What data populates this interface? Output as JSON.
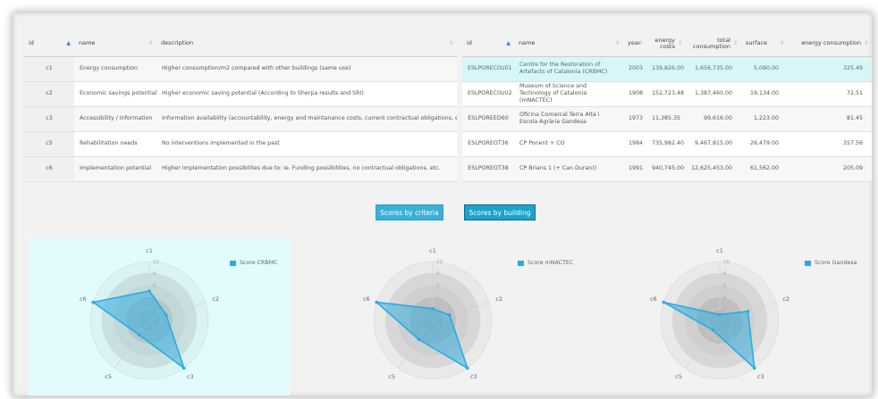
{
  "criteria_table": {
    "headers": {
      "id": "id",
      "name": "name",
      "description": "description"
    },
    "rows": [
      {
        "id": "c1",
        "name": "Energy consumption",
        "description": "Higher consumption/m2 compared with other buildings (same use)"
      },
      {
        "id": "c2",
        "name": "Economic savings potential",
        "description": "Higher economic saving potential (According to Sherpa results and SRI)"
      },
      {
        "id": "c3",
        "name": "Accessibility / Information",
        "description": "Information availability (accountability, energy and maintanance costs, current contractual obligations, etc.)"
      },
      {
        "id": "c5",
        "name": "Rehabilitation needs",
        "description": "No interventions implemented in the past"
      },
      {
        "id": "c6",
        "name": "Implementation potential",
        "description": "Higher implementation possibilites due to: ie. Funding possibilities, no contractual obligations, etc."
      }
    ]
  },
  "buildings_table": {
    "headers": {
      "id": "id",
      "name": "name",
      "year": "year",
      "energy_costs": "energy costs",
      "total_consumption": "total consumption",
      "surface": "surface",
      "energy_consumption": "energy consumption"
    },
    "rows": [
      {
        "id": "ESLPOREC0U01",
        "name": "Centre for the Restoration of Artefacts of Catalonia (CRBMC)",
        "year": "2003",
        "energy_costs": "139,826.00",
        "total_consumption": "1,656,735.00",
        "surface": "5,090.00",
        "energy_consumption": "325.49"
      },
      {
        "id": "ESLPOREC0U02",
        "name": "Museum of Science and Technology of Catalonia (mNACTEC)",
        "year": "1908",
        "energy_costs": "152,723.48",
        "total_consumption": "1,387,460.00",
        "surface": "19,134.00",
        "energy_consumption": "72.51"
      },
      {
        "id": "ESLPOREED60",
        "name": "Oficina Comarcal Terra Alta i Escola Agrària Gandesa",
        "year": "1973",
        "energy_costs": "11,385.35",
        "total_consumption": "99,616.00",
        "surface": "1,223.00",
        "energy_consumption": "81.45"
      },
      {
        "id": "ESLPOREOT36",
        "name": "CP Ponent + CO",
        "year": "1984",
        "energy_costs": "735,982.40",
        "total_consumption": "9,467,815.00",
        "surface": "26,479.00",
        "energy_consumption": "357.56"
      },
      {
        "id": "ESLPOREOT38",
        "name": "CP Brians 1 (+ Can Duran))",
        "year": "1991",
        "energy_costs": "940,745.00",
        "total_consumption": "12,625,453.00",
        "surface": "61,562.00",
        "energy_consumption": "205.09"
      }
    ]
  },
  "buttons": {
    "scores_by_criteria": "Scores by criteria",
    "scores_by_building": "Scores by building"
  },
  "colors": {
    "accent": "#29abe2",
    "selected_row": "#d8f6f8",
    "selected_panel": "#e2fcfd"
  },
  "chart_data": [
    {
      "type": "radar",
      "axes": [
        "c1",
        "c2",
        "c3",
        "c5",
        "c6"
      ],
      "ticks": [
        "2",
        "4",
        "6",
        "8",
        "10"
      ],
      "range": [
        0,
        10
      ],
      "series": [
        {
          "name": "Score CRBMC",
          "values": [
            5,
            3,
            10,
            3,
            10
          ]
        }
      ]
    },
    {
      "type": "radar",
      "axes": [
        "c1",
        "c2",
        "c3",
        "c5",
        "c6"
      ],
      "ticks": [
        "2",
        "4",
        "6",
        "8",
        "10"
      ],
      "range": [
        0,
        10
      ],
      "series": [
        {
          "name": "Score mNACTEC",
          "values": [
            2,
            3,
            10,
            4,
            10
          ]
        }
      ]
    },
    {
      "type": "radar",
      "axes": [
        "c1",
        "c2",
        "c3",
        "c5",
        "c6"
      ],
      "ticks": [
        "2",
        "4",
        "6",
        "8",
        "10"
      ],
      "range": [
        0,
        10
      ],
      "series": [
        {
          "name": "Score Gandesa",
          "values": [
            1,
            5,
            10,
            2,
            10
          ]
        }
      ]
    }
  ]
}
